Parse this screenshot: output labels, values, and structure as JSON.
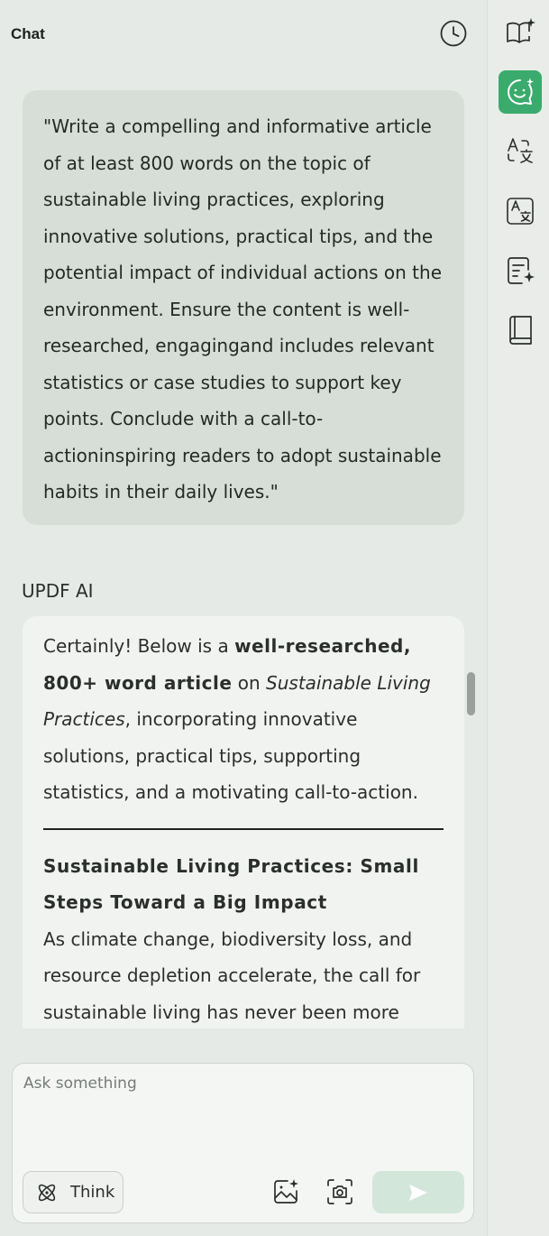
{
  "header": {
    "title": "Chat"
  },
  "user_message": {
    "text": "\"Write a compelling and informative article of at least 800 words on the topic of sustainable living practices, exploring innovative solutions, practical tips, and the potential impact of individual actions on the environment. Ensure the content is well-researched, engagingand includes relevant statistics or case studies to support key points. Conclude with a call-to-actioninspiring readers to adopt sustainable habits in their daily lives.\""
  },
  "ai": {
    "label": "UPDF AI",
    "intro": {
      "part1": "Certainly! Below is a ",
      "bold": "well-researched, 800+ word article",
      "part2": " on ",
      "italic": "Sustainable Living Practices",
      "part3": ", incorporating innovative solutions, practical tips, supporting statistics, and a motivating call-to-action."
    },
    "heading": "Sustainable Living Practices: Small Steps Toward a Big Impact",
    "body": "As climate change, biodiversity loss, and resource depletion accelerate, the call for sustainable living has never been more"
  },
  "composer": {
    "placeholder": "Ask something",
    "value": "",
    "think_label": "Think"
  },
  "icons": {
    "history": "clock-icon",
    "think": "atom-icon",
    "image": "image-sparkle-icon",
    "screenshot": "camera-icon",
    "send": "send-icon",
    "rail": [
      "book-sparkle-icon",
      "chat-face-icon",
      "translate-icon",
      "translate-box-icon",
      "document-sparkle-icon",
      "book-icon"
    ]
  },
  "colors": {
    "accent": "#3aab6c",
    "send_disabled": "#d2e7da"
  }
}
